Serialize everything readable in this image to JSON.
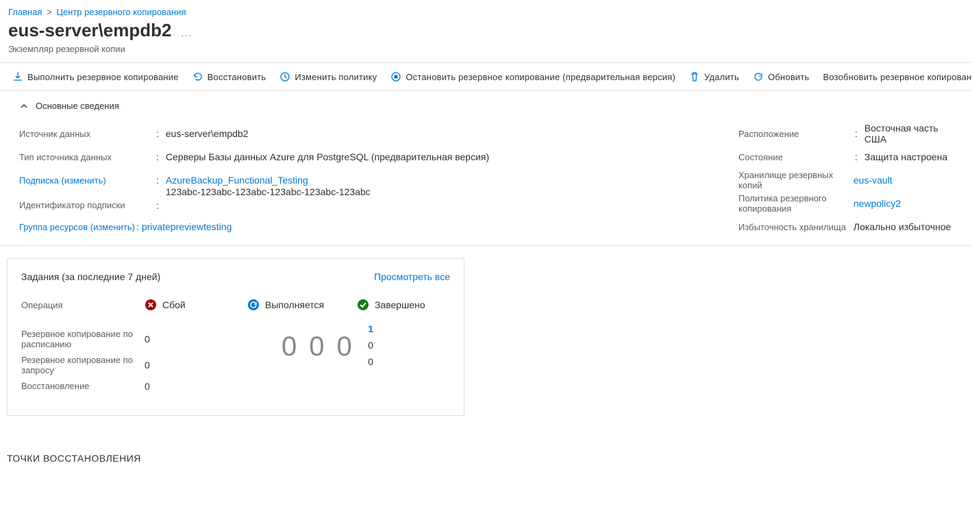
{
  "breadcrumb": {
    "home": "Главная",
    "center": "Центр резервного копирования"
  },
  "page": {
    "title": "eus-server\\empdb2",
    "subtitle": "Экземпляр резервной копии",
    "more": "..."
  },
  "toolbar": {
    "backup_now": "Выполнить резервное копирование",
    "restore": "Восстановить",
    "edit_policy": "Изменить политику",
    "stop_backup": "Остановить резервное копирование (предварительная версия)",
    "delete": "Удалить",
    "refresh": "Обновить",
    "resume": "Возобновить резервное копирование (предваритель"
  },
  "essentials": {
    "heading": "Основные сведения",
    "left": {
      "datasource_label": "Источник данных",
      "datasource_value": "eus-server\\empdb2",
      "datasource_type_label": "Тип источника данных",
      "datasource_type_value": "Серверы Базы данных Azure для PostgreSQL (предварительная версия)",
      "subscription_label": "Подписка (изменить)",
      "subscription_value": "AzureBackup_Functional_Testing",
      "subscription_id_label": "Идентификатор подписки",
      "subscription_id_value": "123abc-123abc-123abc-123abc-123abc-123abc",
      "resource_group_label": "Группа ресурсов (изменить)",
      "resource_group_value": "privatepreviewtesting"
    },
    "right": {
      "location_label": "Расположение",
      "location_value": "Восточная часть США",
      "status_label": "Состояние",
      "status_value": "Защита настроена",
      "vault_label": "Хранилище резервных копий",
      "vault_value": "eus-vault",
      "policy_label": "Политика резервного копирования",
      "policy_value": "newpolicy2",
      "redundancy_label": "Избыточность хранилища",
      "redundancy_value": "Локально избыточное"
    }
  },
  "jobs": {
    "title": "Задания (за последние 7 дней)",
    "view_all": "Просмотреть все",
    "operation_label": "Операция",
    "failed_label": "Сбой",
    "inprogress_label": "Выполняется",
    "completed_label": "Завершено",
    "rows": {
      "scheduled_label": "Резервное копирование по расписанию",
      "ondemand_label": "Резервное копирование по запросу",
      "restore_label": "Восстановление"
    },
    "values": {
      "scheduled_failed": "0",
      "ondemand_failed": "0",
      "restore_failed": "0",
      "center": [
        "0",
        "0",
        "0"
      ],
      "scheduled_done": "1",
      "ondemand_done": "0",
      "restore_done": "0"
    }
  },
  "restore_points": {
    "heading": "ТОЧКИ ВОССТАНОВЛЕНИЯ"
  }
}
